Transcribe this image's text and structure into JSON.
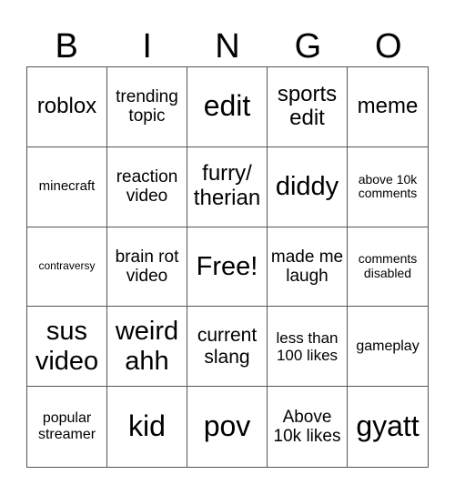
{
  "header": [
    "B",
    "I",
    "N",
    "G",
    "O"
  ],
  "cells": [
    {
      "text": "roblox",
      "size": 24
    },
    {
      "text": "trending topic",
      "size": 19
    },
    {
      "text": "edit",
      "size": 32
    },
    {
      "text": "sports edit",
      "size": 24
    },
    {
      "text": "meme",
      "size": 24
    },
    {
      "text": "minecraft",
      "size": 15
    },
    {
      "text": "reaction video",
      "size": 19
    },
    {
      "text": "furry/ therian",
      "size": 24
    },
    {
      "text": "diddy",
      "size": 29
    },
    {
      "text": "above 10k comments",
      "size": 14
    },
    {
      "text": "contraversy",
      "size": 12
    },
    {
      "text": "brain rot video",
      "size": 19
    },
    {
      "text": "Free!",
      "size": 29
    },
    {
      "text": "made me laugh",
      "size": 19
    },
    {
      "text": "comments disabled",
      "size": 14
    },
    {
      "text": "sus video",
      "size": 29
    },
    {
      "text": "weird ahh",
      "size": 29
    },
    {
      "text": "current slang",
      "size": 21
    },
    {
      "text": "less than 100 likes",
      "size": 17
    },
    {
      "text": "gameplay",
      "size": 16
    },
    {
      "text": "popular streamer",
      "size": 16
    },
    {
      "text": "kid",
      "size": 32
    },
    {
      "text": "pov",
      "size": 32
    },
    {
      "text": "Above 10k likes",
      "size": 19
    },
    {
      "text": "gyatt",
      "size": 32
    }
  ]
}
